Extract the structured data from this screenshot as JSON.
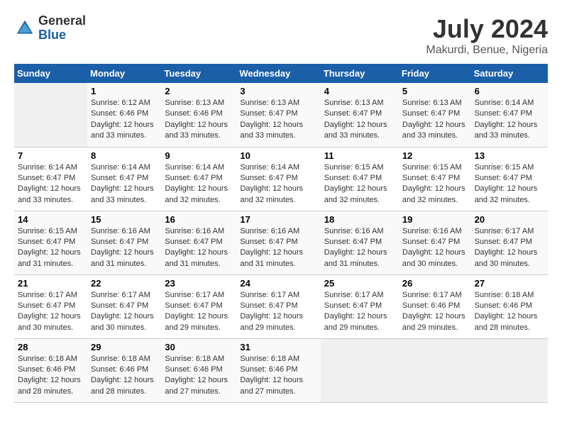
{
  "logo": {
    "general": "General",
    "blue": "Blue"
  },
  "title": {
    "month_year": "July 2024",
    "location": "Makurdi, Benue, Nigeria"
  },
  "days_of_week": [
    "Sunday",
    "Monday",
    "Tuesday",
    "Wednesday",
    "Thursday",
    "Friday",
    "Saturday"
  ],
  "weeks": [
    [
      {
        "day": "",
        "empty": true
      },
      {
        "day": "1",
        "sunrise": "Sunrise: 6:12 AM",
        "sunset": "Sunset: 6:46 PM",
        "daylight": "Daylight: 12 hours and 33 minutes."
      },
      {
        "day": "2",
        "sunrise": "Sunrise: 6:13 AM",
        "sunset": "Sunset: 6:46 PM",
        "daylight": "Daylight: 12 hours and 33 minutes."
      },
      {
        "day": "3",
        "sunrise": "Sunrise: 6:13 AM",
        "sunset": "Sunset: 6:47 PM",
        "daylight": "Daylight: 12 hours and 33 minutes."
      },
      {
        "day": "4",
        "sunrise": "Sunrise: 6:13 AM",
        "sunset": "Sunset: 6:47 PM",
        "daylight": "Daylight: 12 hours and 33 minutes."
      },
      {
        "day": "5",
        "sunrise": "Sunrise: 6:13 AM",
        "sunset": "Sunset: 6:47 PM",
        "daylight": "Daylight: 12 hours and 33 minutes."
      },
      {
        "day": "6",
        "sunrise": "Sunrise: 6:14 AM",
        "sunset": "Sunset: 6:47 PM",
        "daylight": "Daylight: 12 hours and 33 minutes."
      }
    ],
    [
      {
        "day": "7",
        "sunrise": "Sunrise: 6:14 AM",
        "sunset": "Sunset: 6:47 PM",
        "daylight": "Daylight: 12 hours and 33 minutes."
      },
      {
        "day": "8",
        "sunrise": "Sunrise: 6:14 AM",
        "sunset": "Sunset: 6:47 PM",
        "daylight": "Daylight: 12 hours and 33 minutes."
      },
      {
        "day": "9",
        "sunrise": "Sunrise: 6:14 AM",
        "sunset": "Sunset: 6:47 PM",
        "daylight": "Daylight: 12 hours and 32 minutes."
      },
      {
        "day": "10",
        "sunrise": "Sunrise: 6:14 AM",
        "sunset": "Sunset: 6:47 PM",
        "daylight": "Daylight: 12 hours and 32 minutes."
      },
      {
        "day": "11",
        "sunrise": "Sunrise: 6:15 AM",
        "sunset": "Sunset: 6:47 PM",
        "daylight": "Daylight: 12 hours and 32 minutes."
      },
      {
        "day": "12",
        "sunrise": "Sunrise: 6:15 AM",
        "sunset": "Sunset: 6:47 PM",
        "daylight": "Daylight: 12 hours and 32 minutes."
      },
      {
        "day": "13",
        "sunrise": "Sunrise: 6:15 AM",
        "sunset": "Sunset: 6:47 PM",
        "daylight": "Daylight: 12 hours and 32 minutes."
      }
    ],
    [
      {
        "day": "14",
        "sunrise": "Sunrise: 6:15 AM",
        "sunset": "Sunset: 6:47 PM",
        "daylight": "Daylight: 12 hours and 31 minutes."
      },
      {
        "day": "15",
        "sunrise": "Sunrise: 6:16 AM",
        "sunset": "Sunset: 6:47 PM",
        "daylight": "Daylight: 12 hours and 31 minutes."
      },
      {
        "day": "16",
        "sunrise": "Sunrise: 6:16 AM",
        "sunset": "Sunset: 6:47 PM",
        "daylight": "Daylight: 12 hours and 31 minutes."
      },
      {
        "day": "17",
        "sunrise": "Sunrise: 6:16 AM",
        "sunset": "Sunset: 6:47 PM",
        "daylight": "Daylight: 12 hours and 31 minutes."
      },
      {
        "day": "18",
        "sunrise": "Sunrise: 6:16 AM",
        "sunset": "Sunset: 6:47 PM",
        "daylight": "Daylight: 12 hours and 31 minutes."
      },
      {
        "day": "19",
        "sunrise": "Sunrise: 6:16 AM",
        "sunset": "Sunset: 6:47 PM",
        "daylight": "Daylight: 12 hours and 30 minutes."
      },
      {
        "day": "20",
        "sunrise": "Sunrise: 6:17 AM",
        "sunset": "Sunset: 6:47 PM",
        "daylight": "Daylight: 12 hours and 30 minutes."
      }
    ],
    [
      {
        "day": "21",
        "sunrise": "Sunrise: 6:17 AM",
        "sunset": "Sunset: 6:47 PM",
        "daylight": "Daylight: 12 hours and 30 minutes."
      },
      {
        "day": "22",
        "sunrise": "Sunrise: 6:17 AM",
        "sunset": "Sunset: 6:47 PM",
        "daylight": "Daylight: 12 hours and 30 minutes."
      },
      {
        "day": "23",
        "sunrise": "Sunrise: 6:17 AM",
        "sunset": "Sunset: 6:47 PM",
        "daylight": "Daylight: 12 hours and 29 minutes."
      },
      {
        "day": "24",
        "sunrise": "Sunrise: 6:17 AM",
        "sunset": "Sunset: 6:47 PM",
        "daylight": "Daylight: 12 hours and 29 minutes."
      },
      {
        "day": "25",
        "sunrise": "Sunrise: 6:17 AM",
        "sunset": "Sunset: 6:47 PM",
        "daylight": "Daylight: 12 hours and 29 minutes."
      },
      {
        "day": "26",
        "sunrise": "Sunrise: 6:17 AM",
        "sunset": "Sunset: 6:46 PM",
        "daylight": "Daylight: 12 hours and 29 minutes."
      },
      {
        "day": "27",
        "sunrise": "Sunrise: 6:18 AM",
        "sunset": "Sunset: 6:46 PM",
        "daylight": "Daylight: 12 hours and 28 minutes."
      }
    ],
    [
      {
        "day": "28",
        "sunrise": "Sunrise: 6:18 AM",
        "sunset": "Sunset: 6:46 PM",
        "daylight": "Daylight: 12 hours and 28 minutes."
      },
      {
        "day": "29",
        "sunrise": "Sunrise: 6:18 AM",
        "sunset": "Sunset: 6:46 PM",
        "daylight": "Daylight: 12 hours and 28 minutes."
      },
      {
        "day": "30",
        "sunrise": "Sunrise: 6:18 AM",
        "sunset": "Sunset: 6:46 PM",
        "daylight": "Daylight: 12 hours and 27 minutes."
      },
      {
        "day": "31",
        "sunrise": "Sunrise: 6:18 AM",
        "sunset": "Sunset: 6:46 PM",
        "daylight": "Daylight: 12 hours and 27 minutes."
      },
      {
        "day": "",
        "empty": true
      },
      {
        "day": "",
        "empty": true
      },
      {
        "day": "",
        "empty": true
      }
    ]
  ]
}
